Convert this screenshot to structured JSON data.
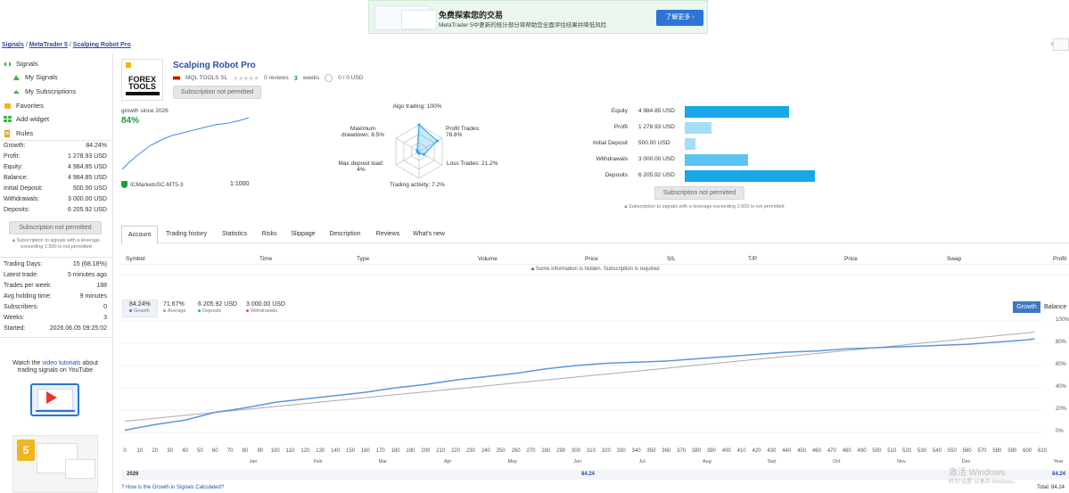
{
  "banner": {
    "title": "免费探索您的交易",
    "subtitle": "MetaTrader 5中更新的统计部分将帮助您全面评估结果并降低风险",
    "button": "了解更多"
  },
  "breadcrumb": [
    "Signals",
    "MetaTrader 5",
    "Scalping Robot Pro"
  ],
  "nav": {
    "signals": "Signals",
    "my_signals": "My Signals",
    "my_subscriptions": "My Subscriptions",
    "favorites": "Favorites",
    "add_widget": "Add widget",
    "rules": "Rules"
  },
  "left_stats": [
    {
      "k": "Growth:",
      "v": "84.24%"
    },
    {
      "k": "Profit:",
      "v": "1 278.93 USD"
    },
    {
      "k": "Equity:",
      "v": "4 984.85 USD"
    },
    {
      "k": "Balance:",
      "v": "4 984.85 USD"
    },
    {
      "k": "Initial Deposit:",
      "v": "500.00 USD"
    },
    {
      "k": "Withdrawals:",
      "v": "3 000.00 USD"
    },
    {
      "k": "Deposits:",
      "v": "6 205.92 USD"
    }
  ],
  "subscribe_label": "Subscription not permitted",
  "leverage_note": "Subscription to signals with a leverage exceeding 1:500 is not permitted",
  "left_stats2": [
    {
      "k": "Trading Days:",
      "v": "15 (68.18%)"
    },
    {
      "k": "Latest trade:",
      "v": "5 minutes ago"
    },
    {
      "k": "Trades per week:",
      "v": "188"
    },
    {
      "k": "Avg holding time:",
      "v": "9 minutes"
    },
    {
      "k": "Subscribers:",
      "v": "0"
    },
    {
      "k": "Weeks:",
      "v": "3"
    },
    {
      "k": "Started:",
      "v": "2026.06.05 09:25:02"
    }
  ],
  "video": {
    "pre": "Watch the ",
    "link": "video tutorials",
    "post": " about trading signals on YouTube"
  },
  "signal": {
    "logo_text": "FOREX TOOLS",
    "title": "Scalping Robot Pro",
    "author": "MQL TOOLS SL",
    "reviews": "0 reviews",
    "weeks_num": "3",
    "weeks_word": "weeks",
    "subscribers": "0 / 0 USD",
    "growth_since": "growth since 2026",
    "growth_value": "84%",
    "broker": "ICMarketsSC-MT5-3",
    "leverage": "1:1000"
  },
  "radar": {
    "algo": "Algo trading: 100%",
    "profit_trades": "Profit Trades:",
    "profit_trades_v": "78.8%",
    "loss_trades": "Loss Trades: 21.2%",
    "activity": "Trading activity: 7.2%",
    "deposit_load": "Max deposit load:",
    "deposit_load_v": "4%",
    "drawdown": "Maximum",
    "drawdown2": "drawdown: 8.5%",
    "values": {
      "algo": 1.0,
      "profit": 0.788,
      "loss": 0.212,
      "activity": 0.072,
      "load": 0.04,
      "drawdown": 0.085
    }
  },
  "bars": [
    {
      "label": "Equity",
      "value": "4 984.85 USD",
      "amount": 4984.85,
      "color": "#1aa7e8"
    },
    {
      "label": "Profit",
      "value": "1 278.93 USD",
      "amount": 1278.93,
      "color": "#a5dcf7"
    },
    {
      "label": "Initial Deposit",
      "value": "500.00 USD",
      "amount": 500,
      "color": "#a5dcf7"
    },
    {
      "label": "Withdrawals",
      "value": "3 000.00 USD",
      "amount": 3000,
      "color": "#5cc4f0"
    },
    {
      "label": "Deposits",
      "value": "6 205.92 USD",
      "amount": 6205.92,
      "color": "#1aa7e8"
    }
  ],
  "tabs": [
    "Account",
    "Trading history",
    "Statistics",
    "Risks",
    "Slippage",
    "Description",
    "Reviews",
    "What's new"
  ],
  "table_headers": [
    "Symbol",
    "Time",
    "Type",
    "Volume",
    "Price",
    "S/L",
    "T/P",
    "Price",
    "Swap",
    "Profit"
  ],
  "hidden_note": "Some information is hidden. Subscription is required",
  "growth_stats": [
    {
      "value": "84.24%",
      "label": "Growth",
      "color": "#3e78c4"
    },
    {
      "value": "71.67%",
      "label": "Average",
      "color": "#999999"
    },
    {
      "value": "6 205.92 USD",
      "label": "Deposits",
      "color": "#3bb54a"
    },
    {
      "value": "3 000.00 USD",
      "label": "Withdrawals",
      "color": "#e04a3a"
    }
  ],
  "chart_toggle": {
    "growth": "Growth",
    "balance": "Balance"
  },
  "chart_data": {
    "type": "line",
    "x_ticks": [
      "0",
      "10",
      "20",
      "30",
      "40",
      "50",
      "60",
      "70",
      "80",
      "90",
      "100",
      "110",
      "120",
      "130",
      "140",
      "150",
      "160",
      "170",
      "180",
      "190",
      "200",
      "210",
      "220",
      "230",
      "240",
      "250",
      "260",
      "270",
      "280",
      "290",
      "300",
      "310",
      "320",
      "330",
      "340",
      "350",
      "360",
      "370",
      "380",
      "390",
      "400",
      "410",
      "420",
      "430",
      "440",
      "450",
      "460",
      "470",
      "480",
      "490",
      "500",
      "510",
      "520",
      "530",
      "540",
      "550",
      "560",
      "570",
      "580",
      "590",
      "600",
      "610"
    ],
    "months": [
      "Jan",
      "Feb",
      "Mar",
      "Apr",
      "May",
      "Jun",
      "Jul",
      "Aug",
      "Sep",
      "Oct",
      "Nov",
      "Dec"
    ],
    "year": "Year",
    "y_ticks": [
      "100%",
      "80%",
      "60%",
      "40%",
      "20%",
      "0%"
    ],
    "ylim": [
      0,
      100
    ],
    "xlim": [
      0,
      610
    ],
    "series": [
      {
        "values_x": [
          0,
          20,
          40,
          60,
          80,
          100,
          120,
          140,
          160,
          180,
          200,
          220,
          240,
          260,
          280,
          300,
          320,
          340,
          360,
          380,
          400,
          420,
          440,
          460,
          480,
          500,
          520,
          540,
          560,
          580,
          600,
          605
        ],
        "values_y": [
          2,
          7,
          11,
          18,
          22,
          27,
          30,
          33,
          36,
          40,
          43,
          47,
          50,
          53,
          57,
          60,
          62,
          63,
          64,
          66,
          68,
          70,
          72,
          73,
          75,
          76,
          77,
          78,
          79,
          81,
          83,
          84
        ]
      },
      {
        "values_x": [
          0,
          605
        ],
        "values_y": [
          10,
          90
        ]
      }
    ]
  },
  "year_row": {
    "label": "2026",
    "value": "84.24",
    "value_right": "84.24"
  },
  "how_calc": "How is the Growth in Signals Calculated?",
  "total": "Total: 84.24",
  "watermark": "激活 Windows",
  "watermark_sub": "转到\"设置\"以激活 Windows。"
}
